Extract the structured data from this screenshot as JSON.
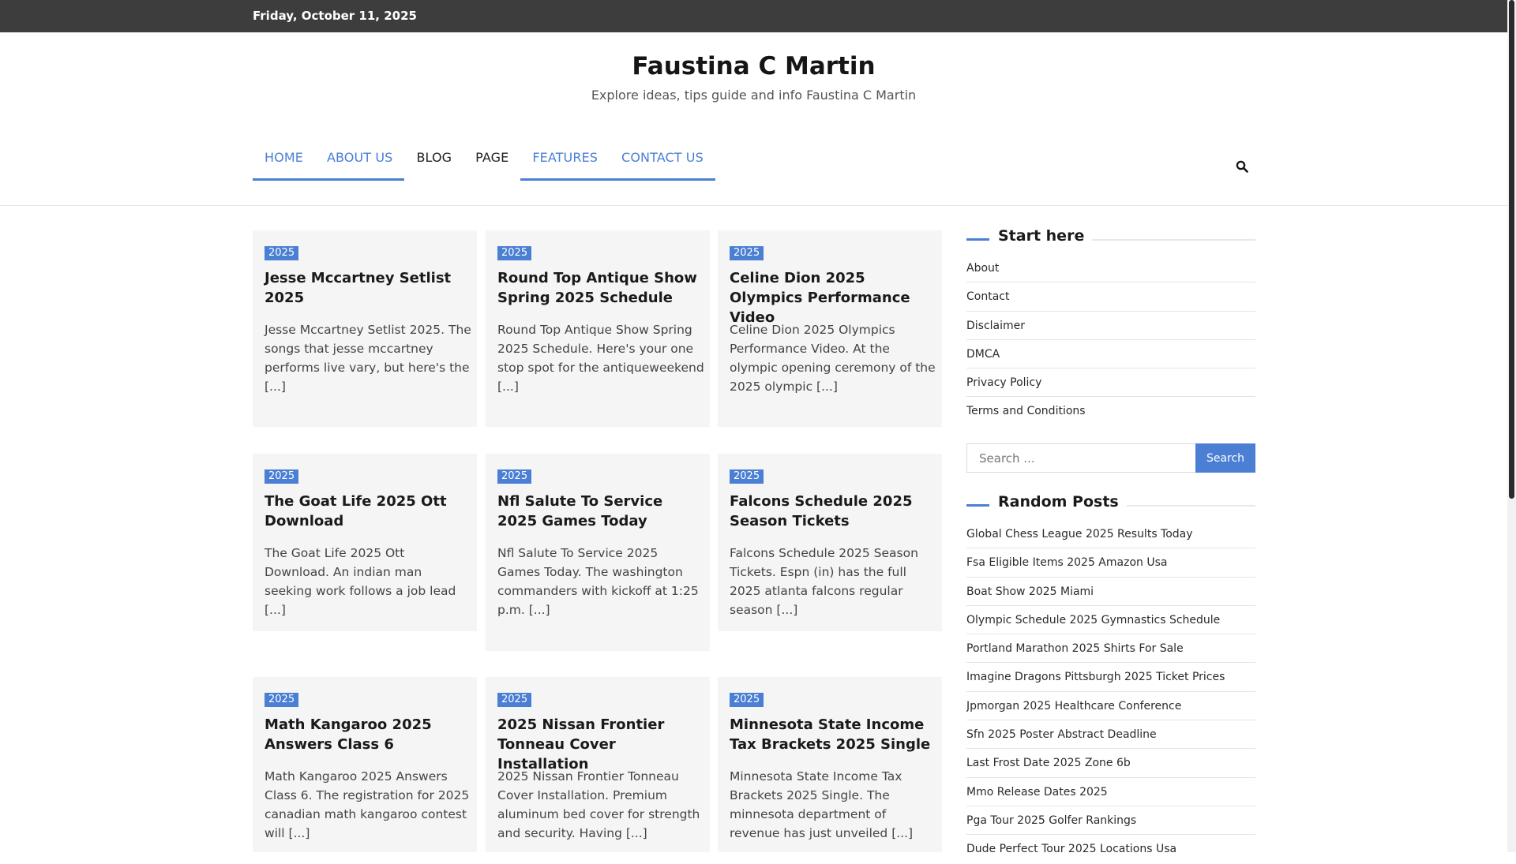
{
  "topbar": {
    "date": "Friday, October 11, 2025"
  },
  "site": {
    "title": "Faustina C Martin",
    "tagline": "Explore ideas, tips guide and info Faustina C Martin"
  },
  "nav": {
    "items": [
      {
        "label": "HOME",
        "active": true
      },
      {
        "label": "ABOUT US",
        "active": true
      },
      {
        "label": "BLOG",
        "active": false
      },
      {
        "label": "PAGE",
        "active": false
      },
      {
        "label": "FEATURES",
        "active": true
      },
      {
        "label": "CONTACT US",
        "active": true
      }
    ],
    "search_icon": "search-icon"
  },
  "posts": [
    {
      "badge": "2025",
      "title": "Jesse Mccartney Setlist 2025",
      "excerpt": "Jesse Mccartney Setlist 2025. The songs that jesse mccartney performs live vary, but here's the [...]"
    },
    {
      "badge": "2025",
      "title": "Round Top Antique Show Spring 2025 Schedule",
      "excerpt": "Round Top Antique Show Spring 2025 Schedule. Here's your one stop spot for the antiqueweekend [...]"
    },
    {
      "badge": "2025",
      "title": "Celine Dion 2025 Olympics Performance Video",
      "excerpt": "Celine Dion 2025 Olympics Performance Video. At the olympic opening ceremony of the 2025 olympic [...]"
    },
    {
      "badge": "2025",
      "title": "The Goat Life 2025 Ott Download",
      "excerpt": "The Goat Life 2025 Ott Download. An indian man seeking work follows a job lead [...]"
    },
    {
      "badge": "2025",
      "title": "Nfl Salute To Service 2025 Games Today",
      "excerpt": "Nfl Salute To Service 2025 Games Today. The washington commanders with kickoff at 1:25 p.m. [...]"
    },
    {
      "badge": "2025",
      "title": "Falcons Schedule 2025 Season Tickets",
      "excerpt": "Falcons Schedule 2025 Season Tickets. Espn (in) has the full 2025 atlanta falcons regular season [...]"
    },
    {
      "badge": "2025",
      "title": "Math Kangaroo 2025 Answers Class 6",
      "excerpt": "Math Kangaroo 2025 Answers Class 6. The registration for 2025 canadian math kangaroo contest will [...]"
    },
    {
      "badge": "2025",
      "title": "2025 Nissan Frontier Tonneau Cover Installation",
      "excerpt": "2025 Nissan Frontier Tonneau Cover Installation. Premium aluminum bed cover for strength and security. Having [...]"
    },
    {
      "badge": "2025",
      "title": "Minnesota State Income Tax Brackets 2025 Single",
      "excerpt": "Minnesota State Income Tax Brackets 2025 Single. The minnesota department of revenue has just unveiled [...]"
    }
  ],
  "sidebar": {
    "start_here": {
      "title": "Start here",
      "links": [
        "About",
        "Contact",
        "Disclaimer",
        "DMCA",
        "Privacy Policy",
        "Terms and Conditions"
      ]
    },
    "search": {
      "placeholder": "Search ...",
      "button": "Search"
    },
    "random_posts": {
      "title": "Random Posts",
      "links": [
        "Global Chess League 2025 Results Today",
        "Fsa Eligible Items 2025 Amazon Usa",
        "Boat Show 2025 Miami",
        "Olympic Schedule 2025 Gymnastics Schedule",
        "Portland Marathon 2025 Shirts For Sale",
        "Imagine Dragons Pittsburgh 2025 Ticket Prices",
        "Jpmorgan 2025 Healthcare Conference",
        "Sfn 2025 Poster Abstract Deadline",
        "Last Frost Date 2025 Zone 6b",
        "Mmo Release Dates 2025",
        "Pga Tour 2025 Golfer Rankings",
        "Dude Perfect Tour 2025 Locations Usa"
      ]
    }
  },
  "colors": {
    "accent": "#4a7fd4",
    "topbar": "#3d3d3d",
    "card_bg": "#f5f5f5"
  }
}
